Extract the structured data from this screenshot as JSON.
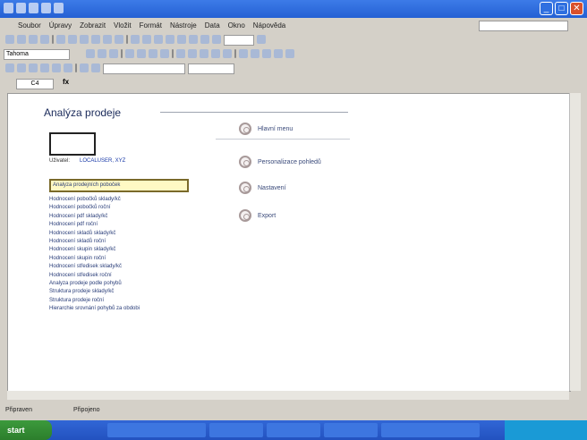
{
  "window": {
    "title": ""
  },
  "menubar": {
    "items": [
      "Soubor",
      "Úpravy",
      "Zobrazit",
      "Vložit",
      "Formát",
      "Nástroje",
      "Data",
      "Okno",
      "Nápověda"
    ],
    "help_placeholder": ""
  },
  "formatting": {
    "font": "Tahoma"
  },
  "formula_bar": {
    "cell_ref": "C4",
    "fx": "fx"
  },
  "sheet": {
    "app_title": "Analýza prodeje",
    "user_label": "Uživatel:",
    "user_value": "LOCALUSER, XYZ",
    "selected_report": "Analyza prodejních poboček",
    "reports": [
      "Hodnocení pobočků sklady/kč",
      "Hodnocení pobočků roční",
      "Hodnocení pdf sklady/kč",
      "Hodnocení pdf roční",
      "Hodnocení skladů sklady/kč",
      "Hodnocení skladů roční",
      "Hodnocení skupin sklady/kč",
      "Hodnocení skupin roční",
      "Hodnocení středisek sklady/kč",
      "Hodnocení středisek roční",
      "Analyza prodeje podle pohybů",
      "Struktura prodeje sklady/kč",
      "Struktura prodeje roční",
      "Hierarchie srovnání pohybů za obdobi"
    ],
    "menu_buttons": [
      {
        "label": "Hlavní menu"
      },
      {
        "label": "Personalizace pohledů"
      },
      {
        "label": "Nastavení"
      },
      {
        "label": "Export"
      }
    ]
  },
  "statusbar": {
    "left": "Připraven",
    "right": "Připojeno"
  },
  "taskbar": {
    "start_label": "start",
    "tasks": [
      "",
      "",
      "",
      "",
      ""
    ],
    "clock": ""
  }
}
